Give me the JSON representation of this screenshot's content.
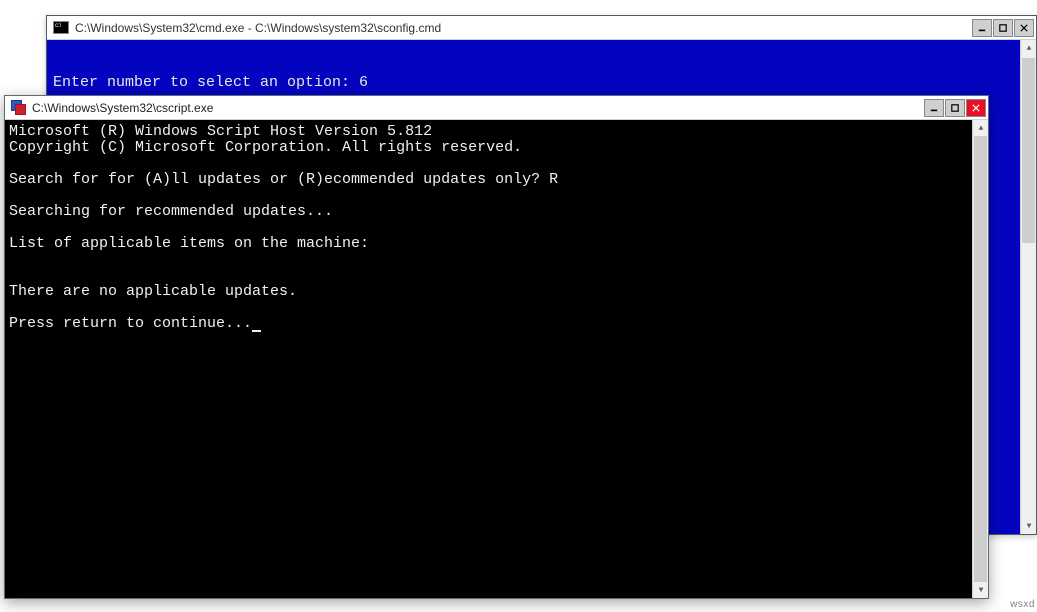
{
  "back_window": {
    "title": "C:\\Windows\\System32\\cmd.exe - C:\\Windows\\system32\\sconfig.cmd",
    "lines": {
      "prompt": "Enter number to select an option: 6"
    }
  },
  "front_window": {
    "title": "C:\\Windows\\System32\\cscript.exe",
    "lines": {
      "l1": "Microsoft (R) Windows Script Host Version 5.812",
      "l2": "Copyright (C) Microsoft Corporation. All rights reserved.",
      "l3": "",
      "l4": "Search for for (A)ll updates or (R)ecommended updates only? R",
      "l5": "",
      "l6": "Searching for recommended updates...",
      "l7": "",
      "l8": "List of applicable items on the machine:",
      "l9": "",
      "l10": "",
      "l11": "There are no applicable updates.",
      "l12": "",
      "l13": "Press return to continue..."
    }
  },
  "watermark": "wsxd"
}
